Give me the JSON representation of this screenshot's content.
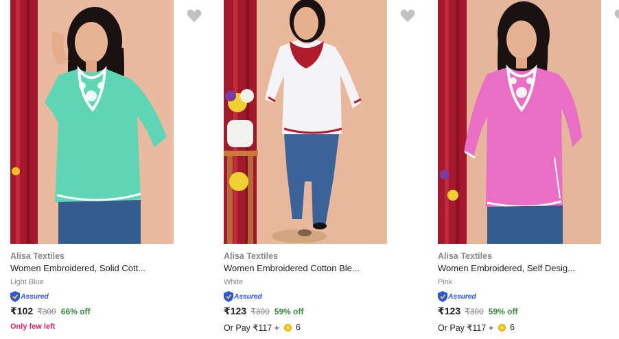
{
  "colors": {
    "price_green": "#388e3c",
    "assured_blue": "#2a55e5",
    "few_left_pink": "#e91e63"
  },
  "products": [
    {
      "brand": "Alisa Textiles",
      "title": "Women Embroidered, Solid Cott...",
      "color": "Light Blue",
      "assured": "Assured",
      "price": "₹102",
      "mrp": "₹300",
      "discount": "66% off",
      "extra": "Only few left",
      "garment_color": "#5fd6b3",
      "embroidery_color": "#ffffff",
      "icon": "heart-icon"
    },
    {
      "brand": "Alisa Textiles",
      "title": "Women Embroidered Cotton Ble...",
      "color": "White",
      "assured": "Assured",
      "price": "₹123",
      "mrp": "₹300",
      "discount": "59% off",
      "pay_prefix": "Or Pay ₹117 +",
      "coins": "6",
      "garment_color": "#f4f4f6",
      "embroidery_color": "#b01c2e",
      "icon": "heart-icon"
    },
    {
      "brand": "Alisa Textiles",
      "title": "Women Embroidered, Self Desig...",
      "color": "Pink",
      "assured": "Assured",
      "price": "₹123",
      "mrp": "₹300",
      "discount": "59% off",
      "pay_prefix": "Or Pay ₹117 +",
      "coins": "6",
      "garment_color": "#e86fc4",
      "embroidery_color": "#ffffff",
      "icon": "heart-icon"
    }
  ]
}
